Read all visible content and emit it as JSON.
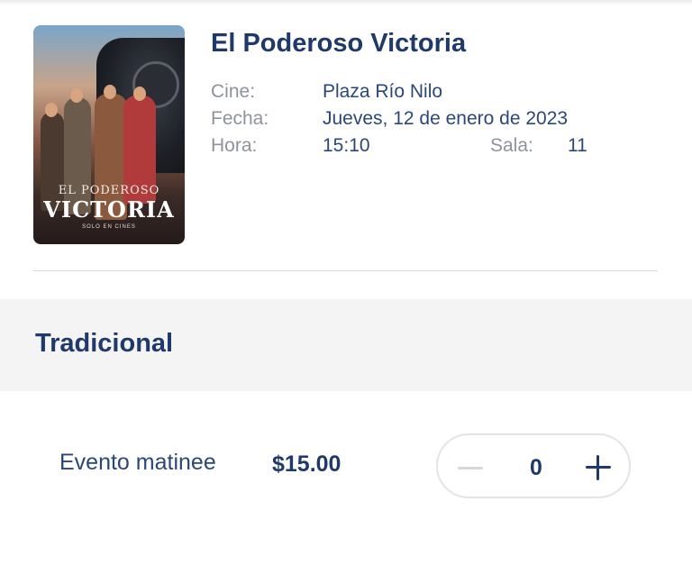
{
  "movie": {
    "title": "El Poderoso Victoria",
    "poster": {
      "title_line1": "EL PODEROSO",
      "title_line2": "VICTORIA",
      "tagline": "SOLO EN CINES"
    },
    "details": {
      "cine_label": "Cine:",
      "cine_value": "Plaza Río Nilo",
      "fecha_label": "Fecha:",
      "fecha_value": "Jueves, 12 de enero de 2023",
      "hora_label": "Hora:",
      "hora_value": "15:10",
      "sala_label": "Sala:",
      "sala_value": "11"
    }
  },
  "section": {
    "title": "Tradicional"
  },
  "ticket": {
    "name": "Evento matinee",
    "price": "$15.00",
    "quantity": "0"
  },
  "colors": {
    "primary": "#1f3a6a",
    "muted_label": "#8e939b",
    "section_bg": "#f4f4f5"
  }
}
